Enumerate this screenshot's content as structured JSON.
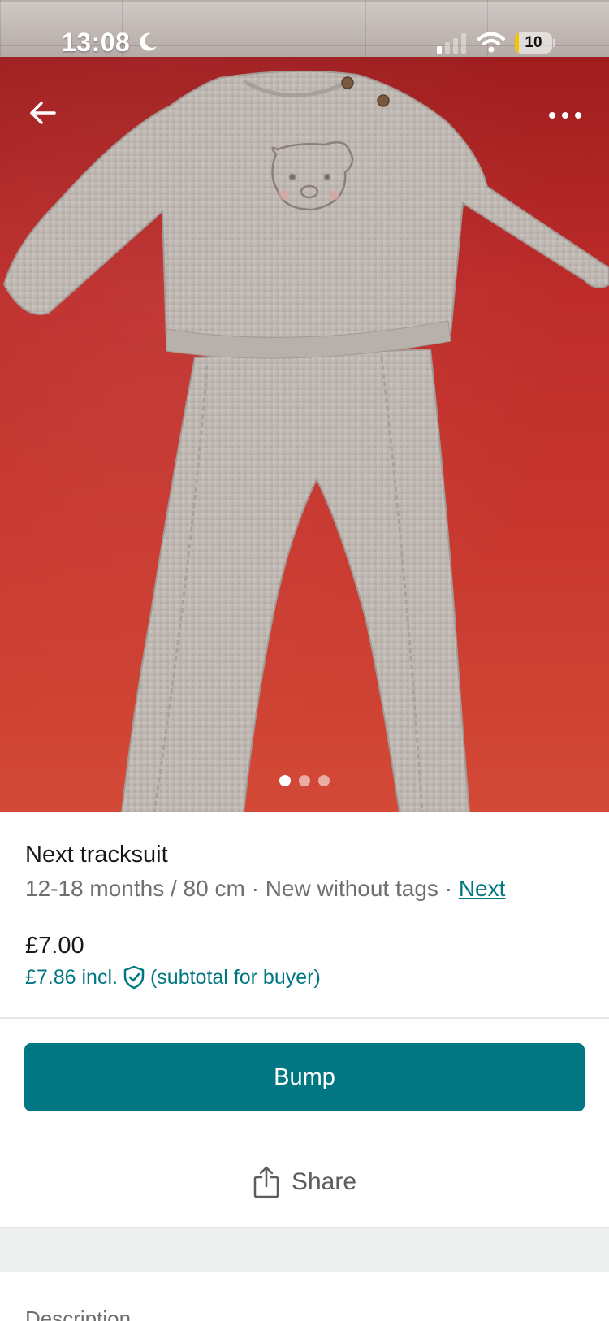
{
  "status_bar": {
    "time": "13:08",
    "battery": "10",
    "battery_level": 0.1
  },
  "nav": {
    "back_icon": "arrow-left-icon",
    "more_icon": "more-horizontal-icon"
  },
  "gallery": {
    "image_count": 3,
    "active_index": 0
  },
  "item": {
    "title": "Next tracksuit",
    "size": "12-18 months / 80 cm",
    "separator": "·",
    "condition": "New without tags",
    "brand": "Next",
    "price": "£7.00",
    "buyer_price": "£7.86 incl.",
    "buyer_price_note": "(subtotal for buyer)"
  },
  "actions": {
    "bump_label": "Bump",
    "share_label": "Share"
  },
  "sections": {
    "description_label": "Description"
  },
  "colors": {
    "accent": "#007782",
    "battery": "#f7c400"
  }
}
